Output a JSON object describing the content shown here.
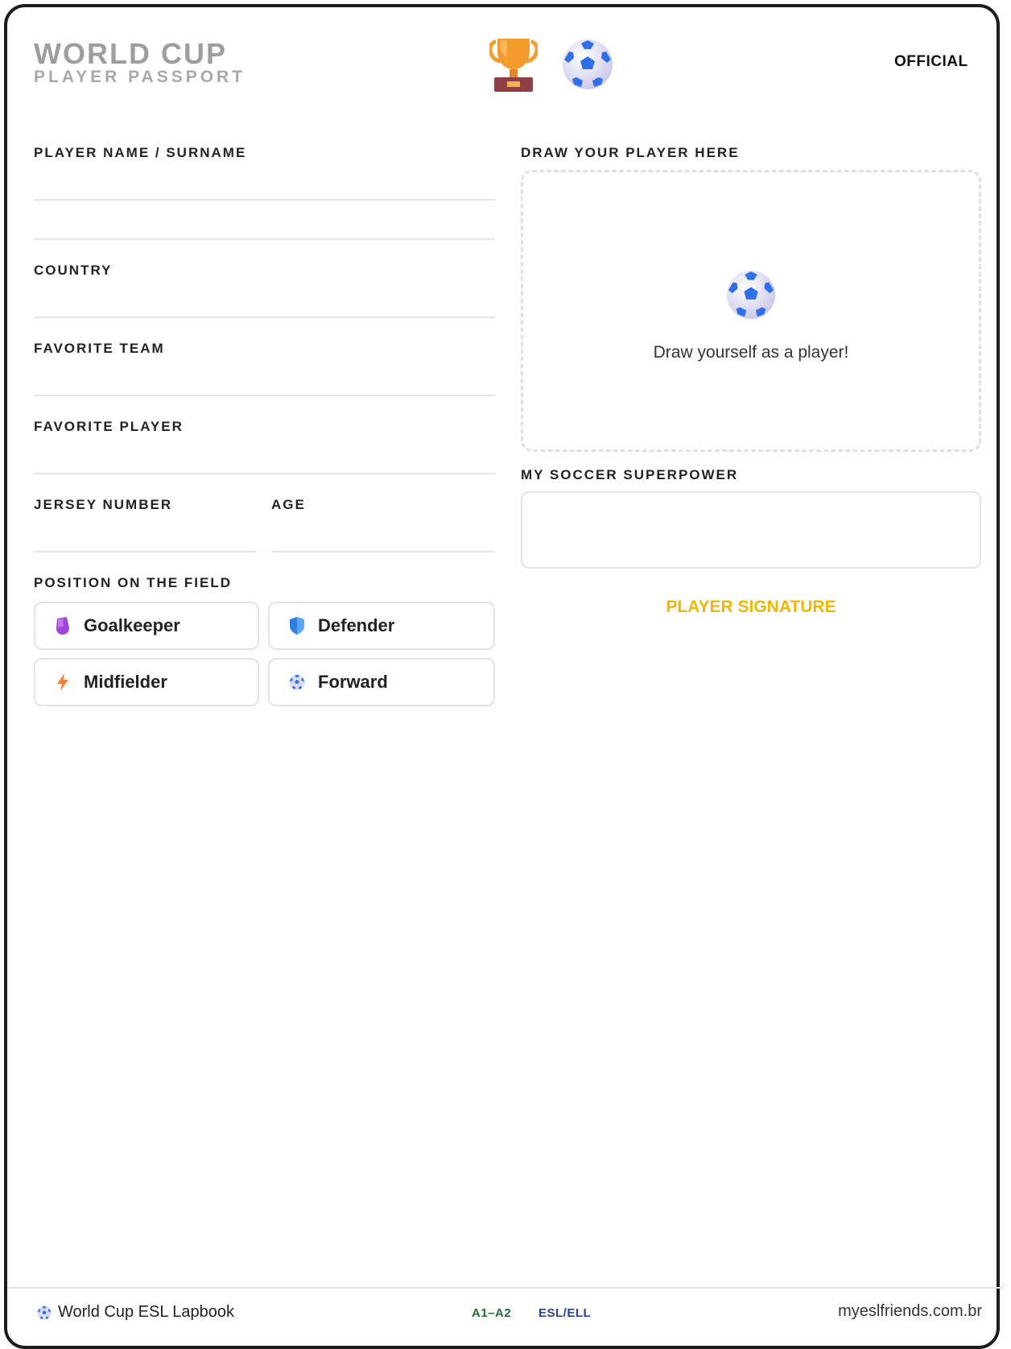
{
  "header": {
    "title": "WORLD CUP",
    "subtitle": "PLAYER PASSPORT",
    "badge": "OFFICIAL",
    "icons": [
      "trophy-icon",
      "soccer-ball-icon"
    ]
  },
  "form": {
    "player_name_label": "PLAYER NAME / SURNAME",
    "country_label": "COUNTRY",
    "favorite_team_label": "FAVORITE TEAM",
    "favorite_player_label": "FAVORITE PLAYER",
    "jersey_number_label": "JERSEY NUMBER",
    "age_label": "AGE",
    "position_label": "POSITION ON THE FIELD",
    "positions": [
      {
        "label": "Goalkeeper",
        "icon": "gloves-icon"
      },
      {
        "label": "Defender",
        "icon": "shield-icon"
      },
      {
        "label": "Midfielder",
        "icon": "lightning-icon"
      },
      {
        "label": "Forward",
        "icon": "soccer-ball-icon"
      }
    ]
  },
  "drawing": {
    "label": "DRAW YOUR PLAYER HERE",
    "caption": "Draw yourself as a player!",
    "icon": "soccer-ball-icon"
  },
  "superpower": {
    "label": "MY SOCCER SUPERPOWER"
  },
  "signature": {
    "label": "PLAYER SIGNATURE",
    "color": "#f2b705"
  },
  "footer": {
    "left": "World Cup ESL Lapbook",
    "level": "A1–A2",
    "program": "ESL/ELL",
    "site": "myeslfriends.com.br"
  }
}
